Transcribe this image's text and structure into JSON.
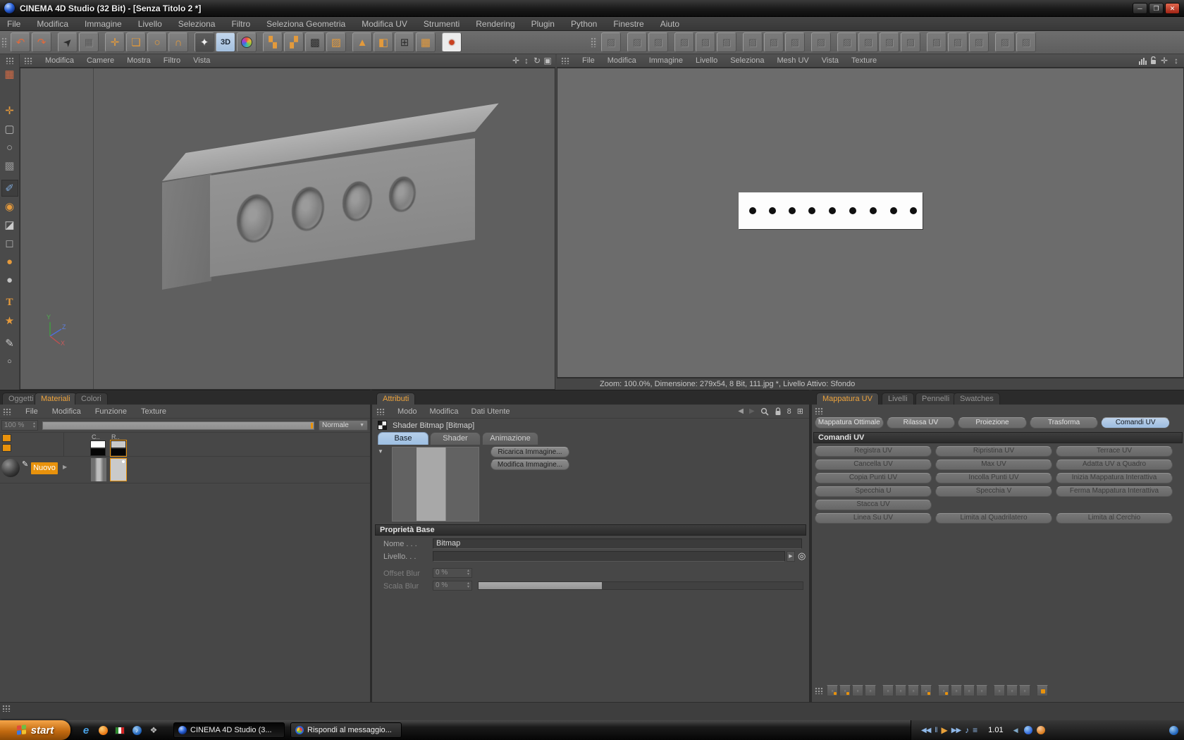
{
  "window": {
    "title": "CINEMA 4D Studio (32 Bit) - [Senza Titolo 2 *]",
    "controls": {
      "minimize": "─",
      "maximize": "❐",
      "close": "✕"
    }
  },
  "menubar": {
    "items": [
      "File",
      "Modifica",
      "Immagine",
      "Livello",
      "Seleziona",
      "Filtro",
      "Seleziona Geometria",
      "Modifica UV",
      "Strumenti",
      "Rendering",
      "Plugin",
      "Python",
      "Finestre",
      "Aiuto"
    ]
  },
  "toolbar": {
    "main_icons": [
      {
        "name": "undo-icon",
        "glyph": "↶"
      },
      {
        "name": "redo-icon",
        "glyph": "↷"
      },
      {
        "name": "selection-arrow-icon",
        "glyph": "➤"
      },
      {
        "name": "live-selection-icon",
        "glyph": "▦"
      },
      {
        "name": "move-tool-icon",
        "glyph": "✛"
      },
      {
        "name": "scale-tool-icon",
        "glyph": "❏"
      },
      {
        "name": "rotate-tool-icon",
        "glyph": "○"
      },
      {
        "name": "magnet-tool-icon",
        "glyph": "∩"
      },
      {
        "name": "brush-stars-icon",
        "glyph": "✦"
      },
      {
        "name": "paint-3d-icon",
        "glyph": "3D"
      },
      {
        "name": "color-wheel-icon",
        "glyph": ""
      },
      {
        "name": "uv-checker-a-icon",
        "glyph": "▚"
      },
      {
        "name": "uv-checker-b-icon",
        "glyph": "▞"
      },
      {
        "name": "uv-checker-c-icon",
        "glyph": "▩"
      },
      {
        "name": "uv-checker-d-icon",
        "glyph": "▨"
      },
      {
        "name": "projection-icon",
        "glyph": "▲"
      },
      {
        "name": "layout-single-icon",
        "glyph": "◧"
      },
      {
        "name": "layout-quad-icon",
        "glyph": "⊞"
      },
      {
        "name": "layout-grid-icon",
        "glyph": "▦"
      },
      {
        "name": "render-icon",
        "glyph": "●"
      }
    ]
  },
  "left_palette": [
    {
      "name": "texture-grid-icon",
      "glyph": "▦"
    },
    {
      "name": "move-icon",
      "glyph": "✛"
    },
    {
      "name": "rect-select-icon",
      "glyph": "▢"
    },
    {
      "name": "lasso-select-icon",
      "glyph": "○"
    },
    {
      "name": "checker-pattern-icon",
      "glyph": "▩"
    },
    {
      "name": "eyedropper-icon",
      "glyph": "✐"
    },
    {
      "name": "clone-stamp-icon",
      "glyph": "◉"
    },
    {
      "name": "eraser-icon",
      "glyph": "◪"
    },
    {
      "name": "cube-icon",
      "glyph": "◻"
    },
    {
      "name": "droplet-icon",
      "glyph": "●"
    },
    {
      "name": "sphere-icon",
      "glyph": "●"
    },
    {
      "name": "text-tool-icon",
      "glyph": "T"
    },
    {
      "name": "star-icon",
      "glyph": "★"
    },
    {
      "name": "pen-icon",
      "glyph": "✎"
    },
    {
      "name": "circle-icon",
      "glyph": "○"
    }
  ],
  "viewport": {
    "menu": [
      "Modifica",
      "Camere",
      "Mostra",
      "Filtro",
      "Vista"
    ],
    "nav_icons": [
      {
        "name": "pan-view-icon",
        "glyph": "✛"
      },
      {
        "name": "zoom-view-icon",
        "glyph": "↕"
      },
      {
        "name": "rotate-view-icon",
        "glyph": "↻"
      },
      {
        "name": "toggle-view-icon",
        "glyph": "▣"
      }
    ],
    "axis_labels": {
      "x": "X",
      "y": "Y",
      "z": "Z"
    }
  },
  "uv_editor": {
    "menu": [
      "File",
      "Modifica",
      "Immagine",
      "Livello",
      "Seleziona",
      "Mesh UV",
      "Vista",
      "Texture"
    ],
    "nav_icons": [
      {
        "name": "pan-texture-icon",
        "glyph": "✛"
      },
      {
        "name": "zoom-texture-icon",
        "glyph": "↕"
      }
    ],
    "status": "Zoom: 100.0%, Dimensione: 279x54, 8 Bit, 111.jpg *, Livello Attivo: Sfondo"
  },
  "panels": {
    "left_tabs": [
      "Oggetti",
      "Materiali",
      "Colori"
    ],
    "attributes_tab": "Attributi",
    "uv_tabs": [
      "Mappatura UV",
      "Livelli",
      "Pennelli",
      "Swatches"
    ]
  },
  "materials": {
    "menu": [
      "File",
      "Modifica",
      "Funzione",
      "Texture"
    ],
    "zoom_value": "100 %",
    "blend_mode": "Normale",
    "col_c": "C..",
    "col_r": "R..",
    "material_name": "Nuovo"
  },
  "attributes": {
    "menu": [
      "Modo",
      "Modifica",
      "Dati Utente"
    ],
    "nav": {
      "back": "◀",
      "forward": "▶",
      "link": "8",
      "add": "⊞"
    },
    "object_header": "Shader Bitmap [Bitmap]",
    "tabs": [
      "Base",
      "Shader",
      "Animazione"
    ],
    "reload_button": "Ricarica Immagine...",
    "edit_button": "Modifica Immagine...",
    "section_title": "Proprietà Base",
    "nome_label": "Nome . . .",
    "nome_value": "Bitmap",
    "livello_label": "Livello. . .",
    "offset_label": "Offset Blur",
    "offset_value": "0 %",
    "scala_label": "Scala Blur",
    "scala_value": "0 %"
  },
  "uv_commands": {
    "modes": [
      "Mappatura Ottimale",
      "Rilassa UV",
      "Proiezione",
      "Trasforma",
      "Comandi UV"
    ],
    "active_mode": "Comandi UV",
    "section_title": "Comandi UV",
    "commands": [
      "Registra UV",
      "Ripristina UV",
      "Terrace UV",
      "Cancella UV",
      "Max UV",
      "Adatta UV a Quadro",
      "Copia Punti UV",
      "Incolla Punti UV",
      "Inizia Mappatura Interattiva",
      "Specchia U",
      "Specchia V",
      "Ferma Mappatura Interattiva",
      "Stacca UV",
      "Linea Su UV",
      "Limita al Quadrilatero",
      "Limita al Cerchio"
    ]
  },
  "taskbar": {
    "start_label": "start",
    "windows": [
      "CINEMA 4D Studio (3...",
      "Rispondi al messaggio..."
    ],
    "clock": "1.01",
    "media": {
      "prev": "◀◀",
      "pause": "‖",
      "play": "▶",
      "next": "▶▶",
      "note": "♪",
      "list": "≡"
    }
  }
}
